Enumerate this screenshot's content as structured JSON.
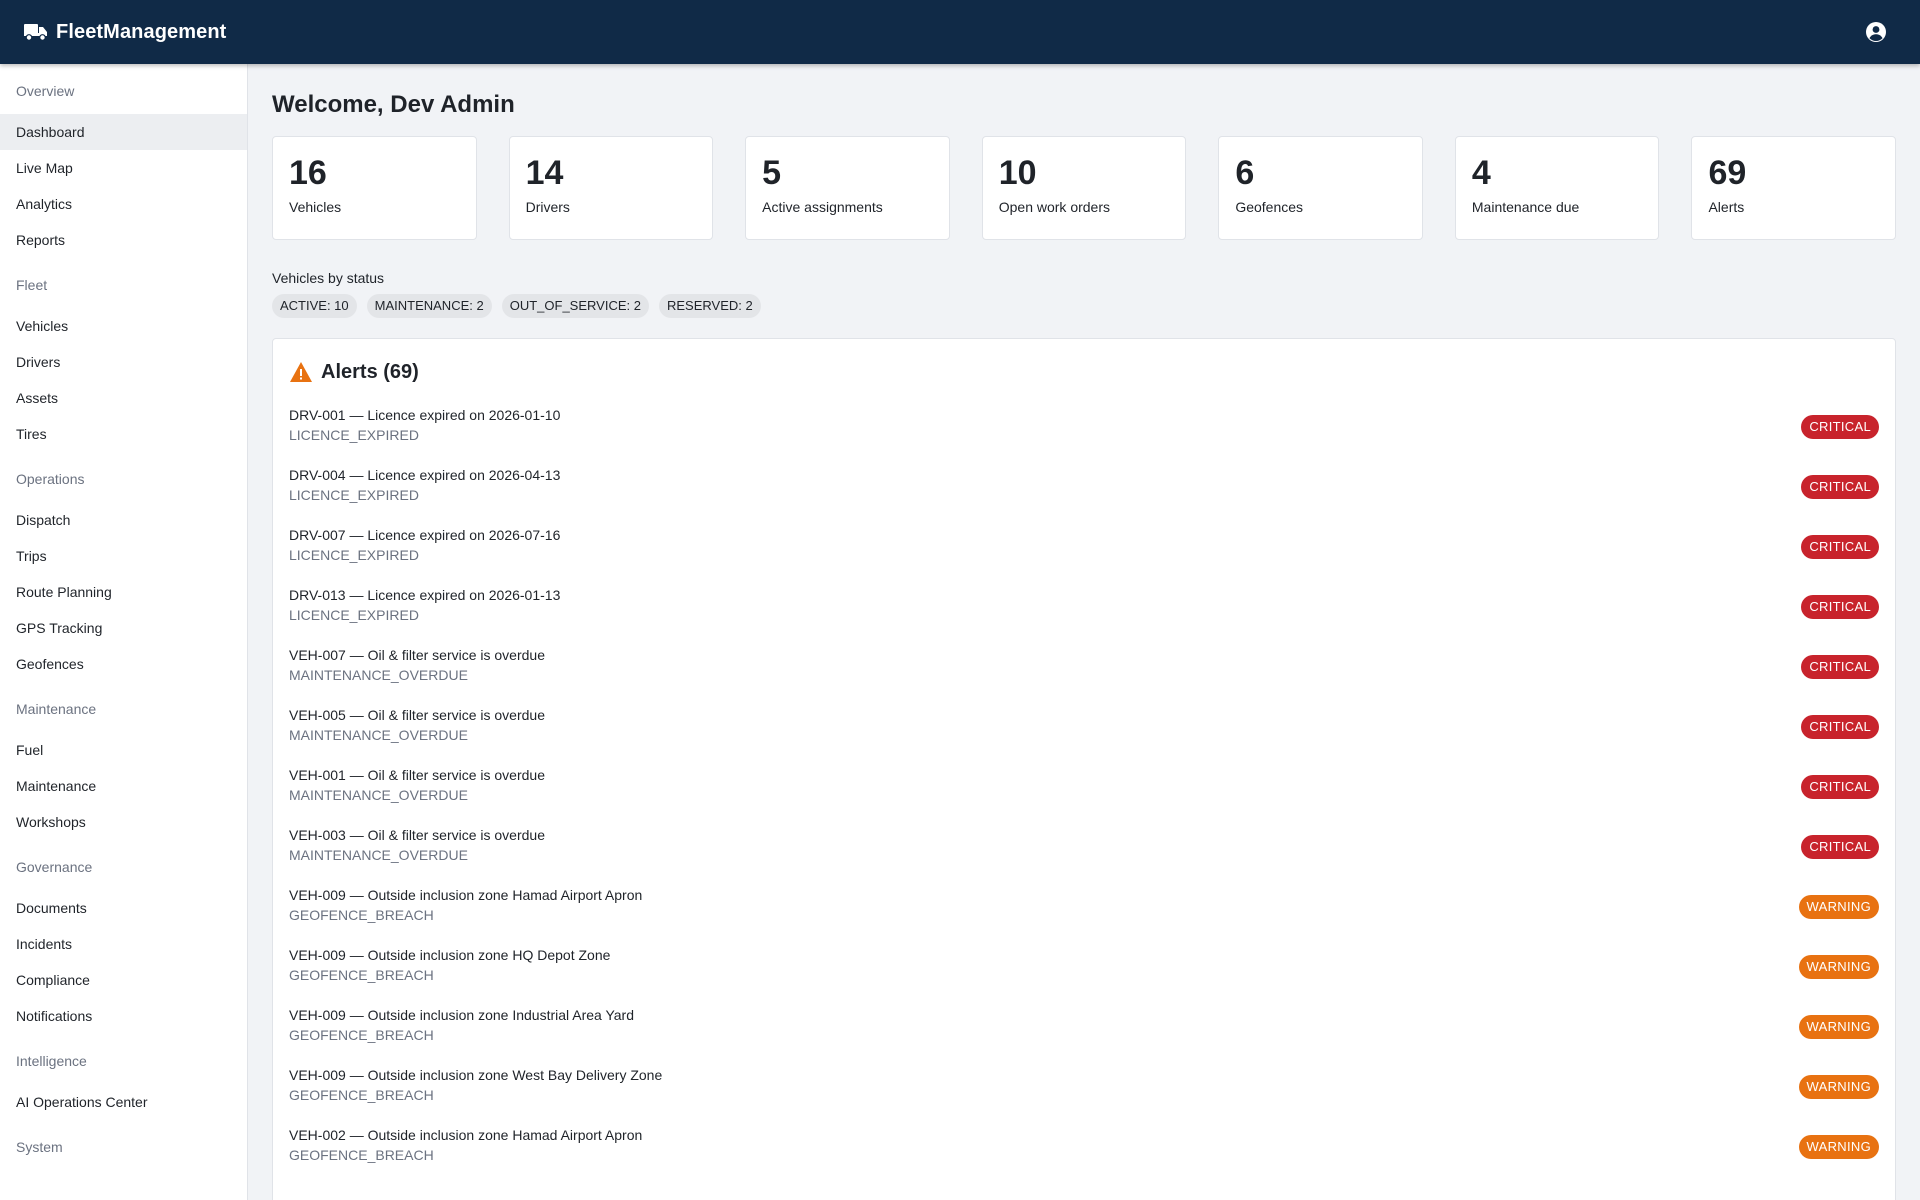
{
  "header": {
    "title": "FleetManagement",
    "logo_icon": "truck-icon",
    "account_icon": "account-circle-icon",
    "background": "#102a47"
  },
  "sidebar": {
    "sections": [
      {
        "header": "Overview",
        "items": [
          {
            "label": "Dashboard",
            "active": true
          },
          {
            "label": "Live Map"
          },
          {
            "label": "Analytics"
          },
          {
            "label": "Reports"
          }
        ]
      },
      {
        "header": "Fleet",
        "items": [
          {
            "label": "Vehicles"
          },
          {
            "label": "Drivers"
          },
          {
            "label": "Assets"
          },
          {
            "label": "Tires"
          }
        ]
      },
      {
        "header": "Operations",
        "items": [
          {
            "label": "Dispatch"
          },
          {
            "label": "Trips"
          },
          {
            "label": "Route Planning"
          },
          {
            "label": "GPS Tracking"
          },
          {
            "label": "Geofences"
          }
        ]
      },
      {
        "header": "Maintenance",
        "items": [
          {
            "label": "Fuel"
          },
          {
            "label": "Maintenance"
          },
          {
            "label": "Workshops"
          }
        ]
      },
      {
        "header": "Governance",
        "items": [
          {
            "label": "Documents"
          },
          {
            "label": "Incidents"
          },
          {
            "label": "Compliance"
          },
          {
            "label": "Notifications"
          }
        ]
      },
      {
        "header": "Intelligence",
        "items": [
          {
            "label": "AI Operations Center"
          }
        ]
      },
      {
        "header": "System",
        "items": []
      }
    ]
  },
  "main": {
    "welcome": "Welcome, Dev Admin",
    "stats": [
      {
        "value": "16",
        "label": "Vehicles"
      },
      {
        "value": "14",
        "label": "Drivers"
      },
      {
        "value": "5",
        "label": "Active assignments"
      },
      {
        "value": "10",
        "label": "Open work orders"
      },
      {
        "value": "6",
        "label": "Geofences"
      },
      {
        "value": "4",
        "label": "Maintenance due"
      },
      {
        "value": "69",
        "label": "Alerts"
      }
    ],
    "vehicles_by_status_label": "Vehicles by status",
    "status_chips": [
      "ACTIVE: 10",
      "MAINTENANCE: 2",
      "OUT_OF_SERVICE: 2",
      "RESERVED: 2"
    ],
    "alerts": {
      "title": "Alerts (69)",
      "icon": "warning-triangle-icon",
      "colors": {
        "critical": "#c8232c",
        "warning": "#e87211"
      },
      "items": [
        {
          "message": "DRV-001 — Licence expired on 2026-01-10",
          "type": "LICENCE_EXPIRED",
          "severity": "CRITICAL"
        },
        {
          "message": "DRV-004 — Licence expired on 2026-04-13",
          "type": "LICENCE_EXPIRED",
          "severity": "CRITICAL"
        },
        {
          "message": "DRV-007 — Licence expired on 2026-07-16",
          "type": "LICENCE_EXPIRED",
          "severity": "CRITICAL"
        },
        {
          "message": "DRV-013 — Licence expired on 2026-01-13",
          "type": "LICENCE_EXPIRED",
          "severity": "CRITICAL"
        },
        {
          "message": "VEH-007 — Oil & filter service is overdue",
          "type": "MAINTENANCE_OVERDUE",
          "severity": "CRITICAL"
        },
        {
          "message": "VEH-005 — Oil & filter service is overdue",
          "type": "MAINTENANCE_OVERDUE",
          "severity": "CRITICAL"
        },
        {
          "message": "VEH-001 — Oil & filter service is overdue",
          "type": "MAINTENANCE_OVERDUE",
          "severity": "CRITICAL"
        },
        {
          "message": "VEH-003 — Oil & filter service is overdue",
          "type": "MAINTENANCE_OVERDUE",
          "severity": "CRITICAL"
        },
        {
          "message": "VEH-009 — Outside inclusion zone Hamad Airport Apron",
          "type": "GEOFENCE_BREACH",
          "severity": "WARNING"
        },
        {
          "message": "VEH-009 — Outside inclusion zone HQ Depot Zone",
          "type": "GEOFENCE_BREACH",
          "severity": "WARNING"
        },
        {
          "message": "VEH-009 — Outside inclusion zone Industrial Area Yard",
          "type": "GEOFENCE_BREACH",
          "severity": "WARNING"
        },
        {
          "message": "VEH-009 — Outside inclusion zone West Bay Delivery Zone",
          "type": "GEOFENCE_BREACH",
          "severity": "WARNING"
        },
        {
          "message": "VEH-002 — Outside inclusion zone Hamad Airport Apron",
          "type": "GEOFENCE_BREACH",
          "severity": "WARNING"
        }
      ]
    }
  }
}
